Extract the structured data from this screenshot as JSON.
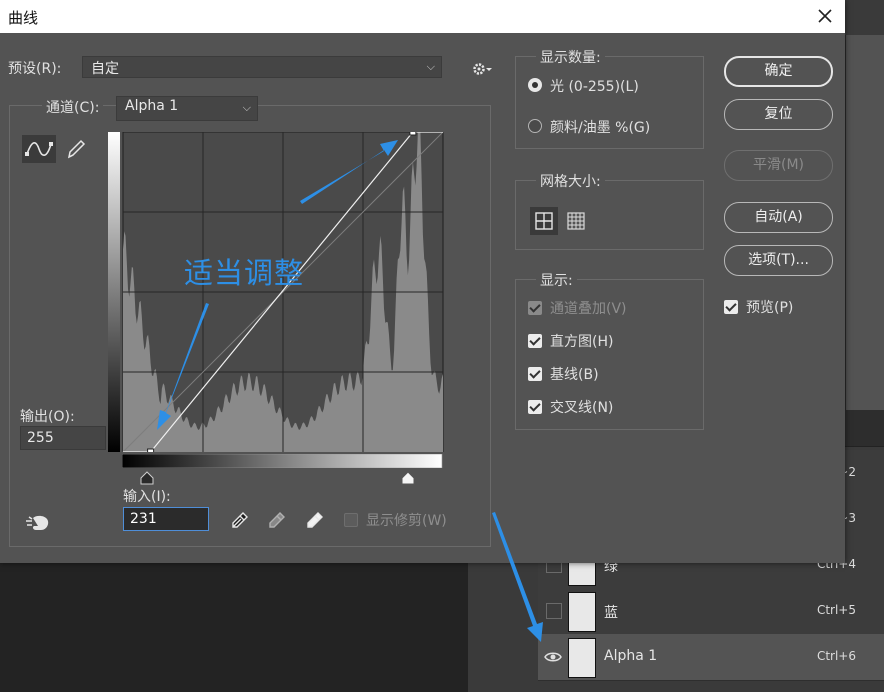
{
  "dialog": {
    "title": "曲线",
    "preset": {
      "label": "预设(R):",
      "value": "自定"
    },
    "channel": {
      "label": "通道(C):",
      "value": "Alpha 1"
    },
    "output": {
      "label": "输出(O):",
      "value": "255"
    },
    "input": {
      "label": "输入(I):",
      "value": "231"
    },
    "show_clipping": "显示修剪(W)",
    "annotation": "适当调整"
  },
  "display_amount": {
    "title": "显示数量:",
    "options": [
      {
        "label": "光 (0-255)(L)",
        "selected": true
      },
      {
        "label": "颜料/油墨 %(G)",
        "selected": false
      }
    ]
  },
  "grid_size": {
    "title": "网格大小:"
  },
  "show": {
    "title": "显示:",
    "items": [
      {
        "label": "通道叠加(V)",
        "checked": true,
        "disabled": true
      },
      {
        "label": "直方图(H)",
        "checked": true,
        "disabled": false
      },
      {
        "label": "基线(B)",
        "checked": true,
        "disabled": false
      },
      {
        "label": "交叉线(N)",
        "checked": true,
        "disabled": false
      }
    ]
  },
  "buttons": {
    "ok": "确定",
    "reset": "复位",
    "smooth": "平滑(M)",
    "auto": "自动(A)",
    "options": "选项(T)..."
  },
  "preview": {
    "label": "预览(P)",
    "checked": true
  },
  "layers": [
    {
      "name": "",
      "shortcut": "~2",
      "visible": false
    },
    {
      "name": "",
      "shortcut": "~3",
      "visible": false
    },
    {
      "name": "绿",
      "shortcut": "Ctrl+4",
      "visible": false
    },
    {
      "name": "蓝",
      "shortcut": "Ctrl+5",
      "visible": false
    },
    {
      "name": "Alpha 1",
      "shortcut": "Ctrl+6",
      "visible": true,
      "selected": true
    }
  ],
  "curve": {
    "points": [
      [
        22,
        0
      ],
      [
        231,
        255
      ]
    ],
    "histogram_peaks": "left-low-bump, right-tall-peaks"
  },
  "colors": {
    "annotation": "#2d8fe6",
    "dialog_bg": "#535353",
    "input_focus": "#4f8ed8"
  }
}
